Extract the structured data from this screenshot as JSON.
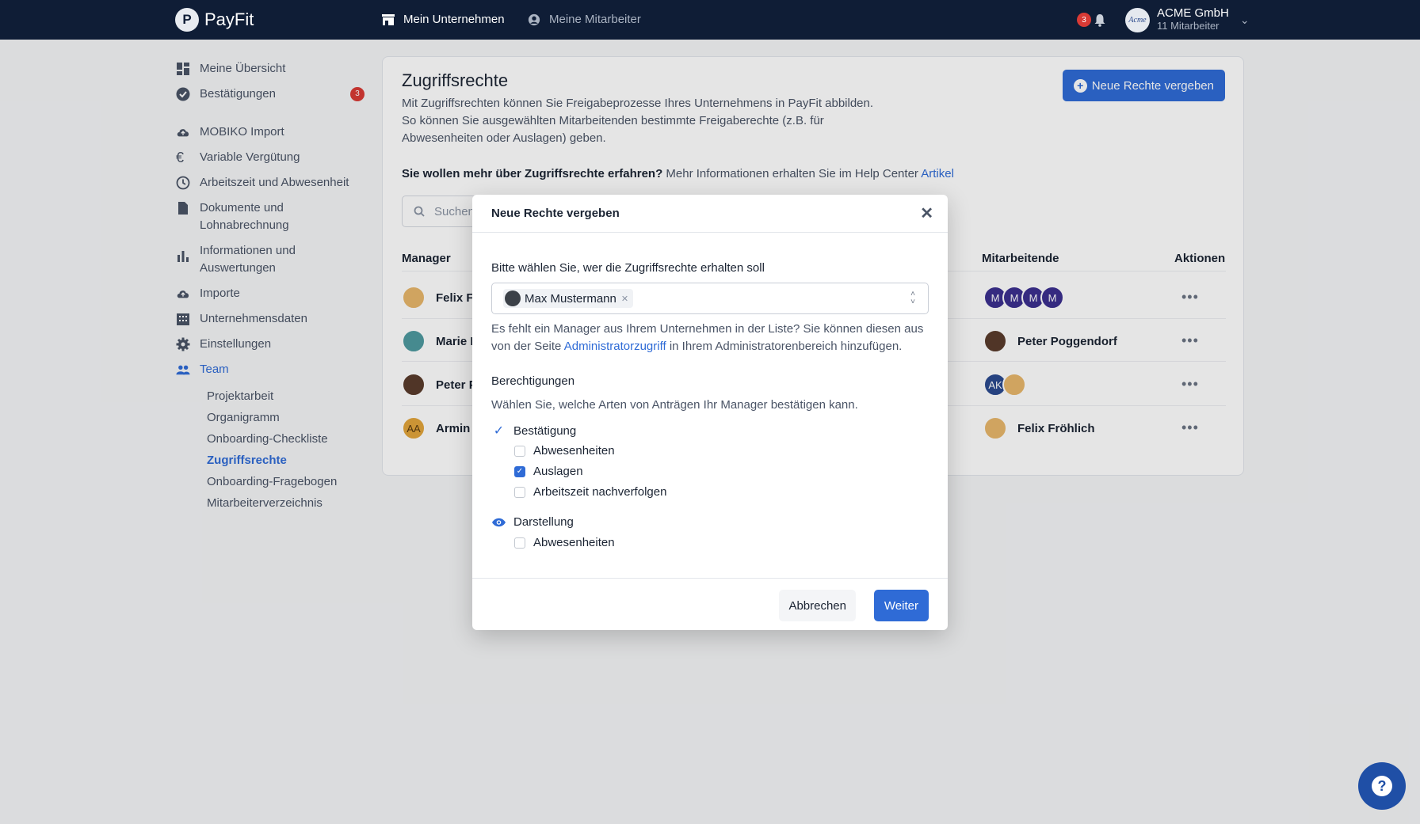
{
  "topnav": {
    "brand": "PayFit",
    "brand_mark": "P",
    "nav": [
      {
        "label": "Mein Unternehmen",
        "icon": "store-icon"
      },
      {
        "label": "Meine Mitarbeiter",
        "icon": "user-circle-icon"
      }
    ],
    "notifications_count": "3",
    "company_name": "ACME GmbH",
    "company_sub": "11 Mitarbeiter",
    "company_logo_text": "Acme"
  },
  "sidebar": {
    "items": [
      {
        "label": "Meine Übersicht",
        "icon": "dashboard-icon"
      },
      {
        "label": "Bestätigungen",
        "icon": "check-circle-icon",
        "badge": "3"
      },
      {
        "label": "MOBIKO Import",
        "icon": "cloud-upload-icon"
      },
      {
        "label": "Variable Vergütung",
        "icon": "euro-icon"
      },
      {
        "label": "Arbeitszeit und Abwesenheit",
        "icon": "clock-icon"
      },
      {
        "label": "Dokumente und Lohnabrechnung",
        "icon": "document-icon"
      },
      {
        "label": "Informationen und Auswertungen",
        "icon": "bar-chart-icon"
      },
      {
        "label": "Importe",
        "icon": "cloud-upload-icon"
      },
      {
        "label": "Unternehmensdaten",
        "icon": "building-icon"
      },
      {
        "label": "Einstellungen",
        "icon": "gear-icon"
      },
      {
        "label": "Team",
        "icon": "people-icon"
      }
    ],
    "team_sub": [
      "Projektarbeit",
      "Organigramm",
      "Onboarding-Checkliste",
      "Zugriffsrechte",
      "Onboarding-Fragebogen",
      "Mitarbeiterverzeichnis"
    ]
  },
  "main": {
    "title": "Zugriffsrechte",
    "description": "Mit Zugriffsrechten können Sie Freigabeprozesse Ihres Unternehmens in PayFit abbilden. So können Sie ausgewählten Mitarbeitenden bestimmte Freigaberechte (z.B. für Abwesenheiten oder Auslagen) geben.",
    "new_rights_button": "Neue Rechte vergeben",
    "more_info_bold": "Sie wollen mehr über Zugriffsrechte erfahren?",
    "more_info_text": " Mehr Informationen erhalten Sie im Help Center ",
    "more_info_link": "Artikel",
    "search_placeholder": "Suchen",
    "columns": {
      "manager": "Manager",
      "employees": "Mitarbeitende",
      "actions": "Aktionen"
    },
    "rows": [
      {
        "manager": "Felix Fr",
        "employees_initials": [
          "M",
          "M",
          "M",
          "M"
        ],
        "employee_name": ""
      },
      {
        "manager": "Marie K",
        "employees_initials": [],
        "employee_name": "Peter Poggendorf"
      },
      {
        "manager": "Peter P",
        "employees_initials": [
          "AK"
        ],
        "employee_name": ""
      },
      {
        "manager": "Armin A",
        "manager_initials": "AA",
        "employees_initials": [],
        "employee_name": "Felix Fröhlich"
      }
    ],
    "actions_glyph": "•••"
  },
  "modal": {
    "title": "Neue Rechte vergeben",
    "select_label": "Bitte wählen Sie, wer die Zugriffsrechte erhalten soll",
    "selected_chip": "Max Mustermann",
    "hint_before": "Es fehlt ein Manager aus Ihrem Unternehmen in der Liste? Sie können diesen aus von der Seite ",
    "hint_link": "Administratorzugriff",
    "hint_after": " in Ihrem Administratorenbereich hinzufügen.",
    "permissions_title": "Berechtigungen",
    "permissions_desc": "Wählen Sie, welche Arten von Anträgen Ihr Manager bestätigen kann.",
    "groups": [
      {
        "label": "Bestätigung",
        "icon": "check-icon",
        "options": [
          {
            "label": "Abwesenheiten",
            "checked": false
          },
          {
            "label": "Auslagen",
            "checked": true
          },
          {
            "label": "Arbeitszeit nachverfolgen",
            "checked": false
          }
        ]
      },
      {
        "label": "Darstellung",
        "icon": "eye-icon",
        "options": [
          {
            "label": "Abwesenheiten",
            "checked": false
          }
        ]
      }
    ],
    "cancel": "Abbrechen",
    "next": "Weiter"
  },
  "colors": {
    "accent": "#2f6bd6",
    "nav_bg": "#0f1d36",
    "badge": "#d93a35",
    "avatar_purple": "#3b2f8f",
    "avatar_blue": "#2b4a8f",
    "avatar_orange": "#e3a53b"
  },
  "help_glyph": "?"
}
